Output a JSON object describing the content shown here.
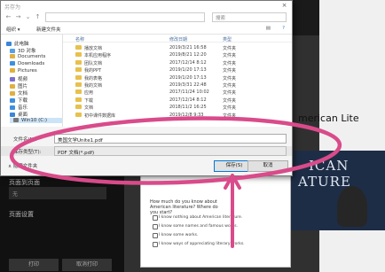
{
  "dialog": {
    "title": "另存为",
    "address": "",
    "search_placeholder": "搜索",
    "organize": "组织 ▾",
    "new_folder": "新建文件夹",
    "nav_items": [
      {
        "label": "此电脑",
        "icon": "computer-icon",
        "color": "#3a86d8"
      },
      {
        "label": "3D 对象",
        "icon": "cube-icon",
        "color": "#56a0e6"
      },
      {
        "label": "Documents",
        "icon": "document-icon",
        "color": "#e0b040"
      },
      {
        "label": "Downloads",
        "icon": "download-icon",
        "color": "#3d8fe0"
      },
      {
        "label": "Pictures",
        "icon": "picture-icon",
        "color": "#e0b040"
      },
      {
        "label": "视频",
        "icon": "video-icon",
        "color": "#7a6fd0"
      },
      {
        "label": "图片",
        "icon": "image-icon",
        "color": "#e0b040"
      },
      {
        "label": "文档",
        "icon": "document-icon",
        "color": "#e0b040"
      },
      {
        "label": "下载",
        "icon": "download-icon",
        "color": "#3d8fe0"
      },
      {
        "label": "音乐",
        "icon": "music-icon",
        "color": "#3d8fe0"
      },
      {
        "label": "桌面",
        "icon": "desktop-icon",
        "color": "#3a86d8"
      },
      {
        "label": "Win10 (C:)",
        "icon": "drive-icon",
        "color": "#777777"
      }
    ],
    "columns": {
      "name": "名称",
      "date": "修改日期",
      "type": "类型"
    },
    "files": [
      {
        "name": "播放文档",
        "date": "2019/3/21 16:58",
        "type": "文件夹"
      },
      {
        "name": "本机应用程序",
        "date": "2019/8/21 12:20",
        "type": "文件夹"
      },
      {
        "name": "团队文档",
        "date": "2017/12/14 8:12",
        "type": "文件夹"
      },
      {
        "name": "我的PPT",
        "date": "2019/1/20 17:13",
        "type": "文件夹"
      },
      {
        "name": "我的表格",
        "date": "2019/1/20 17:13",
        "type": "文件夹"
      },
      {
        "name": "我的文档",
        "date": "2019/3/31 22:48",
        "type": "文件夹"
      },
      {
        "name": "应用",
        "date": "2017/11/24 10:02",
        "type": "文件夹"
      },
      {
        "name": "下载",
        "date": "2017/12/14 8:12",
        "type": "文件夹"
      },
      {
        "name": "文档",
        "date": "2018/11/2 16:25",
        "type": "文件夹"
      },
      {
        "name": "初中课件数据库",
        "date": "2019/12/8 9:33",
        "type": "文件夹"
      }
    ],
    "file_name_label": "文件名(N):",
    "file_name_value": "美国文学Unite1.pdf",
    "file_type_label": "保存类型(T):",
    "file_type_value": "PDF 文档(*.pdf)",
    "hide_folders": "∧ 隐藏文件夹",
    "save_button": "保存(S)",
    "cancel_button": "取消"
  },
  "background": {
    "title_fragment": "merican Lite",
    "cover_line1": "ICAN",
    "cover_line2": "ATURE",
    "left_labels": [
      "页面到页面",
      "页面设置"
    ],
    "left_field": "无",
    "left_buttons": [
      "打印",
      "取消打印"
    ],
    "doc_question": "How much do you know about American literature? Where do you start?",
    "doc_options": [
      "I know nothing about American literature.",
      "I know some names and famous works.",
      "I know some works.",
      "I know ways of appreciating literary works."
    ]
  },
  "annotation": {
    "color": "#d94b8a"
  }
}
